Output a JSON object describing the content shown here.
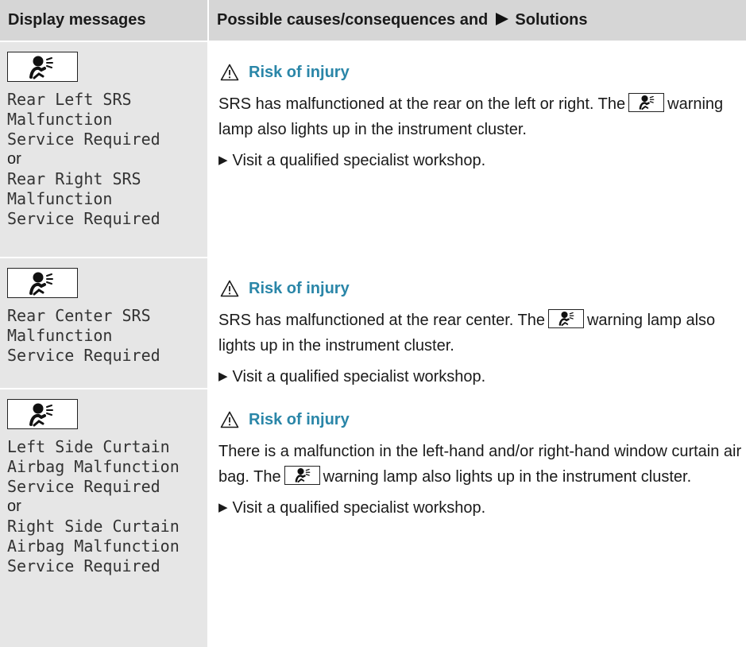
{
  "header": {
    "col1": "Display messages",
    "col2_before": "Possible causes/consequences and",
    "col2_after": "Solutions"
  },
  "rows": [
    {
      "message_lines": [
        "Rear Left SRS",
        "Malfunction",
        "Service Required"
      ],
      "or_label": "or",
      "message_lines_2": [
        "Rear Right SRS",
        "Malfunction",
        "Service Required"
      ],
      "warning": "Risk of injury",
      "desc_before": "SRS has malfunctioned at the rear on the left or right. The",
      "desc_after": "warning lamp also lights up in the instrument cluster.",
      "solution": "Visit a qualified specialist workshop."
    },
    {
      "message_lines": [
        "Rear Center SRS",
        "Malfunction",
        "Service Required"
      ],
      "warning": "Risk of injury",
      "desc_before": "SRS has malfunctioned at the rear center. The",
      "desc_after": "warning lamp also lights up in the instrument cluster.",
      "solution": "Visit a qualified specialist workshop."
    },
    {
      "message_lines": [
        "Left Side Curtain",
        "Airbag Malfunction",
        "Service Required"
      ],
      "or_label": "or",
      "message_lines_2": [
        "Right Side Curtain",
        "Airbag Malfunction",
        "Service Required"
      ],
      "warning": "Risk of injury",
      "desc_before": "There is a malfunction in the left-hand and/or right-hand window curtain air bag. The",
      "desc_after": "warning lamp also lights up in the instrument cluster.",
      "solution": "Visit a qualified specialist workshop."
    }
  ],
  "icons": {
    "airbag": "airbag-warning-icon",
    "warning": "warning-triangle-icon",
    "step": "step-arrow-icon"
  },
  "colors": {
    "header_bg": "#d6d6d6",
    "message_bg": "#e6e6e6",
    "warning_text": "#2a86a8"
  }
}
